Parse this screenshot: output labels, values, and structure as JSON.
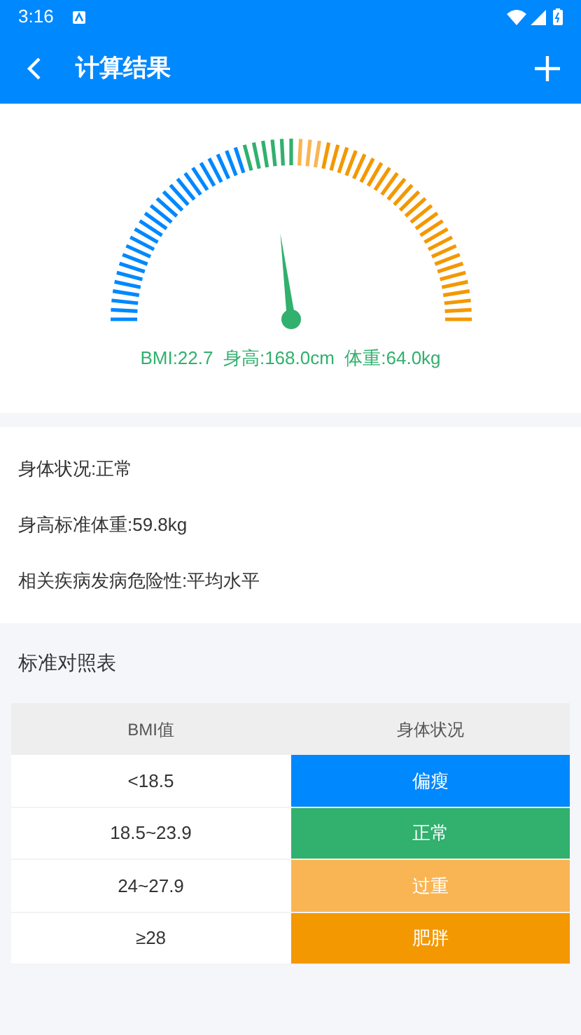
{
  "status_bar": {
    "time": "3:16"
  },
  "app_bar": {
    "title": "计算结果"
  },
  "gauge": {
    "reading": "BMI:22.7  身高:168.0cm  体重:64.0kg"
  },
  "info": [
    "身体状况:正常",
    "身高标准体重:59.8kg",
    "相关疾病发病危险性:平均水平"
  ],
  "table": {
    "title": "标准对照表",
    "columns": [
      "BMI值",
      "身体状况"
    ],
    "rows": [
      {
        "range": "<18.5",
        "status": "偏瘦",
        "color": "#0088fe"
      },
      {
        "range": "18.5~23.9",
        "status": "正常",
        "color": "#31b06e"
      },
      {
        "range": "24~27.9",
        "status": "过重",
        "color": "#f9b554"
      },
      {
        "range": "≥28",
        "status": "肥胖",
        "color": "#f39800"
      }
    ]
  }
}
